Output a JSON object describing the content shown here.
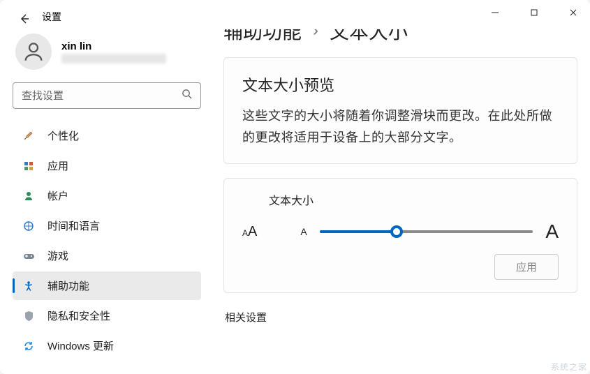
{
  "app_title": "设置",
  "user": {
    "name": "xin lin"
  },
  "search": {
    "placeholder": "查找设置"
  },
  "nav": [
    {
      "label": "个性化"
    },
    {
      "label": "应用"
    },
    {
      "label": "帐户"
    },
    {
      "label": "时间和语言"
    },
    {
      "label": "游戏"
    },
    {
      "label": "辅助功能",
      "active": true
    },
    {
      "label": "隐私和安全性"
    },
    {
      "label": "Windows 更新"
    }
  ],
  "breadcrumb": {
    "parent": "辅助功能",
    "current": "文本大小"
  },
  "preview": {
    "title": "文本大小预览",
    "description": "这些文字的大小将随着你调整滑块而更改。在此处所做的更改将适用于设备上的大部分文字。"
  },
  "text_size": {
    "label": "文本大小",
    "min_glyph": "A",
    "max_glyph": "A",
    "apply_label": "应用",
    "slider_percent": 36
  },
  "related": {
    "heading": "相关设置"
  },
  "watermark": "系统之家"
}
